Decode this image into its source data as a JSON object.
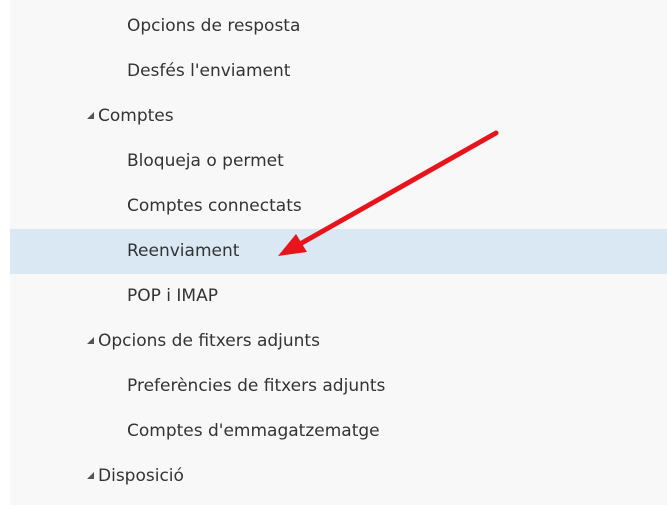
{
  "nav": {
    "items": [
      {
        "label": "Opcions de resposta",
        "type": "child"
      },
      {
        "label": "Desfés l'enviament",
        "type": "child"
      },
      {
        "label": "Comptes",
        "type": "group"
      },
      {
        "label": "Bloqueja o permet",
        "type": "child"
      },
      {
        "label": "Comptes connectats",
        "type": "child"
      },
      {
        "label": "Reenviament",
        "type": "child",
        "selected": true
      },
      {
        "label": "POP i IMAP",
        "type": "child"
      },
      {
        "label": "Opcions de fitxers adjunts",
        "type": "group"
      },
      {
        "label": "Preferències de fitxers adjunts",
        "type": "child"
      },
      {
        "label": "Comptes d'emmagatzematge",
        "type": "child"
      },
      {
        "label": "Disposició",
        "type": "group"
      }
    ]
  },
  "colors": {
    "selected_background": "#dae8f4",
    "panel_background": "#f8f8f8",
    "annotation_arrow": "#e8141b"
  },
  "icons": {
    "group_expander": "expanded-triangle-icon",
    "annotation": "red-arrow-annotation"
  }
}
